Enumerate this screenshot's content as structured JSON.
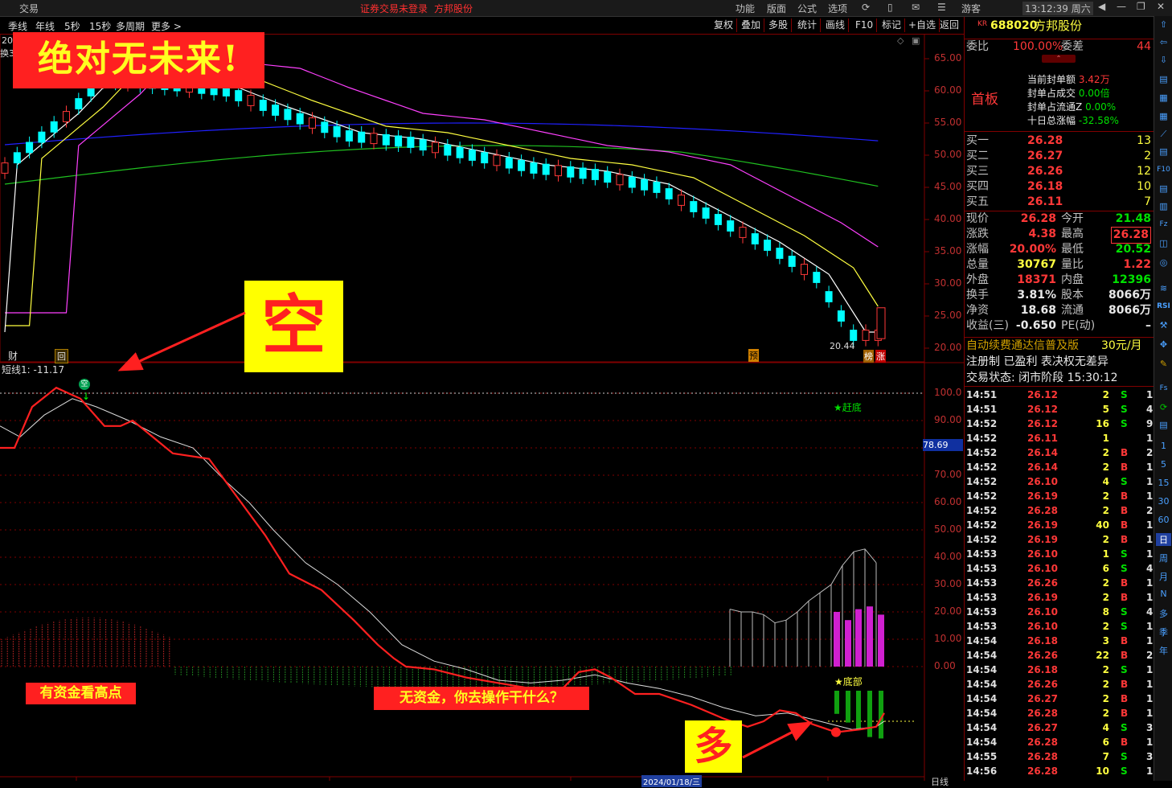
{
  "titlebar": {
    "app": "交易",
    "status": "证券交易未登录",
    "broker": "方邦股份",
    "menus": [
      "功能",
      "版面",
      "公式",
      "选项"
    ],
    "user": "游客",
    "clock": "13:12:39 周六"
  },
  "toolbar": {
    "periods": [
      "季线",
      "年线",
      "5秒",
      "15秒",
      "多周期",
      "更多 >"
    ],
    "buttons": [
      "复权",
      "叠加",
      "多股",
      "统计",
      "画线",
      "F10",
      "标记",
      "+自选",
      "返回"
    ]
  },
  "chart_top": {
    "corner": "20",
    "corner2": "换3",
    "y_ticks": [
      "65.00",
      "60.00",
      "55.00",
      "50.00",
      "45.00",
      "40.00",
      "35.00",
      "30.00",
      "25.00",
      "20.00"
    ],
    "low_label": "20.44",
    "markers": {
      "cai": "财",
      "box": "回",
      "yu": "预",
      "bang": "榜",
      "zhang": "涨"
    }
  },
  "chart_bottom": {
    "indicator": "短线1: -11.17",
    "y_ticks": [
      "100.0",
      "90.00",
      "80.00",
      "70.00",
      "60.00",
      "50.00",
      "40.00",
      "30.00",
      "20.00",
      "10.00",
      "0.00"
    ],
    "current": "78.69",
    "star_top": "★赶底",
    "star_bottom": "★底部",
    "kong_marker": "空",
    "bottom_right": "日线"
  },
  "annotations": {
    "headline": "绝对无未来!",
    "kong": "空",
    "duo": "多",
    "note1": "有资金看高点",
    "note2": "无资金，你去操作干什么？"
  },
  "quote": {
    "market": "KR",
    "code": "688020",
    "name": "方邦股份",
    "weibi_label": "委比",
    "weibi": "100.00%",
    "weicha_label": "委差",
    "weicha": "44",
    "shouban": "首板",
    "seal_amt_label": "当前封单额",
    "seal_amt": "3.42万",
    "seal_vol_label": "封单占成交",
    "seal_vol": "0.00倍",
    "seal_float_label": "封单占流通Z",
    "seal_float": "0.00%",
    "ten_day_label": "十日总涨幅",
    "ten_day": "-32.58%",
    "bids": [
      {
        "label": "买一",
        "price": "26.28",
        "vol": "13"
      },
      {
        "label": "买二",
        "price": "26.27",
        "vol": "2"
      },
      {
        "label": "买三",
        "price": "26.26",
        "vol": "12"
      },
      {
        "label": "买四",
        "price": "26.18",
        "vol": "10"
      },
      {
        "label": "买五",
        "price": "26.11",
        "vol": "7"
      }
    ],
    "stats": [
      {
        "l1": "现价",
        "v1": "26.28",
        "l2": "今开",
        "v2": "21.48"
      },
      {
        "l1": "涨跌",
        "v1": "4.38",
        "l2": "最高",
        "v2": "26.28"
      },
      {
        "l1": "涨幅",
        "v1": "20.00%",
        "l2": "最低",
        "v2": "20.52"
      },
      {
        "l1": "总量",
        "v1": "30767",
        "l2": "量比",
        "v2": "1.22"
      },
      {
        "l1": "外盘",
        "v1": "18371",
        "l2": "内盘",
        "v2": "12396"
      },
      {
        "l1": "换手",
        "v1": "3.81%",
        "l2": "股本",
        "v2": "8066万"
      },
      {
        "l1": "净资",
        "v1": "18.68",
        "l2": "流通",
        "v2": "8066万"
      },
      {
        "l1": "收益(三)",
        "v1": "-0.650",
        "l2": "PE(动)",
        "v2": "–"
      }
    ],
    "promo": "自动续费通达信普及版",
    "promo_price": "30元/月",
    "reg": "注册制 已盈利 表决权无差异",
    "trade_state": "交易状态: 闭市阶段 15:30:12"
  },
  "ticks": [
    {
      "t": "14:51",
      "p": "26.12",
      "v": "2",
      "d": "S",
      "n": "1"
    },
    {
      "t": "14:51",
      "p": "26.12",
      "v": "5",
      "d": "S",
      "n": "4"
    },
    {
      "t": "14:52",
      "p": "26.12",
      "v": "16",
      "d": "S",
      "n": "9"
    },
    {
      "t": "14:52",
      "p": "26.11",
      "v": "1",
      "d": "",
      "n": "1"
    },
    {
      "t": "14:52",
      "p": "26.14",
      "v": "2",
      "d": "B",
      "n": "2"
    },
    {
      "t": "14:52",
      "p": "26.14",
      "v": "2",
      "d": "B",
      "n": "1"
    },
    {
      "t": "14:52",
      "p": "26.10",
      "v": "4",
      "d": "S",
      "n": "1"
    },
    {
      "t": "14:52",
      "p": "26.19",
      "v": "2",
      "d": "B",
      "n": "1"
    },
    {
      "t": "14:52",
      "p": "26.28",
      "v": "2",
      "d": "B",
      "n": "2"
    },
    {
      "t": "14:52",
      "p": "26.19",
      "v": "40",
      "d": "B",
      "n": "1"
    },
    {
      "t": "14:52",
      "p": "26.19",
      "v": "2",
      "d": "B",
      "n": "1"
    },
    {
      "t": "14:53",
      "p": "26.10",
      "v": "1",
      "d": "S",
      "n": "1"
    },
    {
      "t": "14:53",
      "p": "26.10",
      "v": "6",
      "d": "S",
      "n": "4"
    },
    {
      "t": "14:53",
      "p": "26.26",
      "v": "2",
      "d": "B",
      "n": "1"
    },
    {
      "t": "14:53",
      "p": "26.19",
      "v": "2",
      "d": "B",
      "n": "1"
    },
    {
      "t": "14:53",
      "p": "26.10",
      "v": "8",
      "d": "S",
      "n": "4"
    },
    {
      "t": "14:53",
      "p": "26.10",
      "v": "2",
      "d": "S",
      "n": "1"
    },
    {
      "t": "14:54",
      "p": "26.18",
      "v": "3",
      "d": "B",
      "n": "1"
    },
    {
      "t": "14:54",
      "p": "26.26",
      "v": "22",
      "d": "B",
      "n": "2"
    },
    {
      "t": "14:54",
      "p": "26.18",
      "v": "2",
      "d": "S",
      "n": "1"
    },
    {
      "t": "14:54",
      "p": "26.26",
      "v": "2",
      "d": "B",
      "n": "1"
    },
    {
      "t": "14:54",
      "p": "26.27",
      "v": "2",
      "d": "B",
      "n": "1"
    },
    {
      "t": "14:54",
      "p": "26.28",
      "v": "2",
      "d": "B",
      "n": "1"
    },
    {
      "t": "14:54",
      "p": "26.27",
      "v": "4",
      "d": "S",
      "n": "3"
    },
    {
      "t": "14:54",
      "p": "26.28",
      "v": "6",
      "d": "B",
      "n": "1"
    },
    {
      "t": "14:55",
      "p": "26.28",
      "v": "7",
      "d": "S",
      "n": "3"
    },
    {
      "t": "14:56",
      "p": "26.28",
      "v": "10",
      "d": "S",
      "n": "1"
    }
  ],
  "sidebar": {
    "periods": [
      "1",
      "5",
      "15",
      "30",
      "60",
      "日",
      "周",
      "月",
      "N",
      "多",
      "季",
      "年"
    ],
    "labels": [
      "RSI"
    ]
  },
  "date_label": "2024/01/18/三",
  "colors": {
    "up": "#ff3838",
    "down": "#00ffff",
    "ma5": "#ffffff",
    "ma10": "#ffff40",
    "ma20": "#ff40ff",
    "ma60": "#2020ff",
    "ma120": "#20c020"
  }
}
